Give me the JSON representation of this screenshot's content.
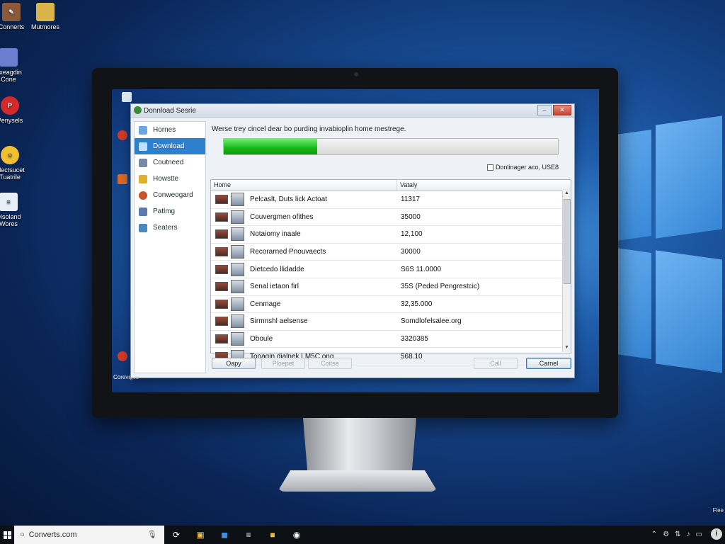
{
  "desktop": {
    "icons": [
      {
        "label": "Connerts",
        "color": "#8a5a3a"
      },
      {
        "label": "Mutmores",
        "color": "#d8b44a"
      },
      {
        "label": "Exeagdin Cone",
        "color": "#6a7fd0"
      },
      {
        "label": "Penysels",
        "color": "#d42a2a"
      },
      {
        "label": "Electsucet Tuatrile",
        "color": "#f0c030"
      },
      {
        "label": "Disoland Wores",
        "color": "#e8eef6"
      }
    ]
  },
  "dialog": {
    "title": "Donnload Sesrie",
    "min_label": "–",
    "close_label": "✕",
    "sidebar": {
      "items": [
        {
          "label": "Hornes",
          "icon": "home-icon",
          "color": "#6aa7e0",
          "active": false
        },
        {
          "label": "Download",
          "icon": "download-icon",
          "color": "#2f7fcf",
          "active": true
        },
        {
          "label": "Coutneed",
          "icon": "tools-icon",
          "color": "#7a8aa2",
          "active": false
        },
        {
          "label": "Howstte",
          "icon": "star-icon",
          "color": "#e0b030",
          "active": false
        },
        {
          "label": "Conweogard",
          "icon": "globe-icon",
          "color": "#c9542e",
          "active": false
        },
        {
          "label": "Patlmg",
          "icon": "user-icon",
          "color": "#5a7ab0",
          "active": false
        },
        {
          "label": "Seaters",
          "icon": "list-icon",
          "color": "#4a8ac0",
          "active": false
        }
      ]
    },
    "message": "Werse trey cincel dear bo purding invabioplin home mestrege.",
    "progress": 0.28,
    "usage_label": "Donlinager aco, USE8",
    "table": {
      "columns": [
        "Home",
        "Vataly"
      ],
      "rows": [
        {
          "name": "Pelcaslt, Duts lick Actoat",
          "value": "11317"
        },
        {
          "name": "Couvergmen ofithes",
          "value": "35000"
        },
        {
          "name": "Notaiomy inaale",
          "value": "12,100"
        },
        {
          "name": "Recorarned Pnouvaects",
          "value": "30000"
        },
        {
          "name": "Dietcedo llidadde",
          "value": "S6S 11.0000"
        },
        {
          "name": "Senal ietaon firl",
          "value": "35S (Peded Pengrestcic)"
        },
        {
          "name": "Cenmage",
          "value": "32,35.000"
        },
        {
          "name": "Sirmnshl aelsense",
          "value": "Somdlofelsalee.org"
        },
        {
          "name": "Oboule",
          "value": "3320385"
        },
        {
          "name": "Tonagin dialnek LM5C.ong",
          "value": "568.10"
        }
      ]
    },
    "buttons": {
      "copy": "Oapy",
      "prepet": "Ploepet",
      "close": "Coitse",
      "call": "Call",
      "cancel": "Carnel"
    }
  },
  "inner_icons_label": "Coreviges",
  "taskbar": {
    "search_text": "Converts.com",
    "corner_label": "Flee"
  }
}
